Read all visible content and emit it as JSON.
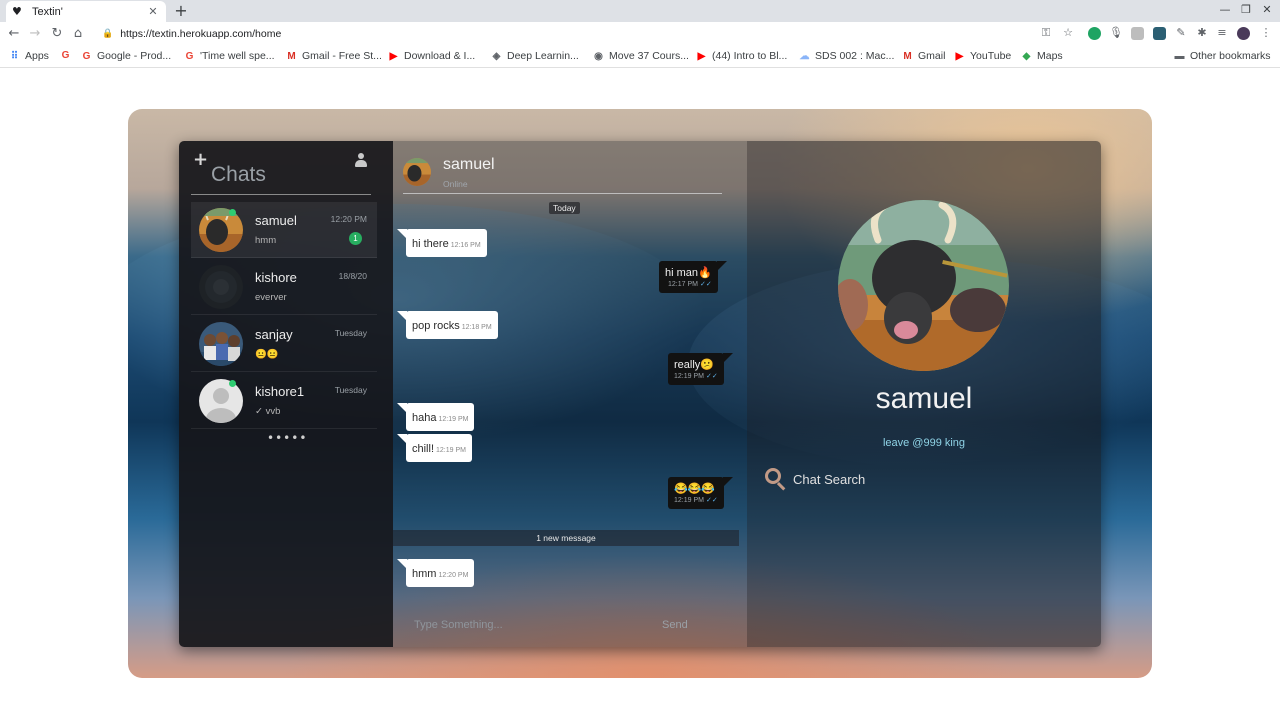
{
  "browser": {
    "tab_title": "Textin'",
    "url": "https://textin.herokuapp.com/home",
    "bookmarks": [
      {
        "label": "Apps",
        "icon": "apps-grid-icon"
      },
      {
        "label": "G",
        "icon": "google-icon"
      },
      {
        "label": "Google - Prod...",
        "icon": "google-icon"
      },
      {
        "label": "'Time well spe...",
        "icon": "google-icon"
      },
      {
        "label": "Gmail - Free St...",
        "icon": "gmail-icon"
      },
      {
        "label": "Download & I...",
        "icon": "youtube-icon"
      },
      {
        "label": "Deep Learnin...",
        "icon": "bookmark-icon"
      },
      {
        "label": "Move 37 Cours...",
        "icon": "bookmark-icon"
      },
      {
        "label": "(44) Intro to Bl...",
        "icon": "youtube-icon"
      },
      {
        "label": "SDS 002 : Mac...",
        "icon": "bookmark-icon"
      },
      {
        "label": "Gmail",
        "icon": "gmail-icon"
      },
      {
        "label": "YouTube",
        "icon": "youtube-icon"
      },
      {
        "label": "Maps",
        "icon": "maps-icon"
      }
    ],
    "other_bookmarks": "Other bookmarks"
  },
  "sidebar": {
    "title": "Chats",
    "chats": [
      {
        "name": "samuel",
        "time": "12:20 PM",
        "preview": "hmm",
        "unread": "1",
        "online": true,
        "active": true
      },
      {
        "name": "kishore",
        "time": "18/8/20",
        "preview": "everver",
        "unread": "",
        "online": false,
        "active": false
      },
      {
        "name": "sanjay",
        "time": "Tuesday",
        "preview": "😐😐",
        "unread": "",
        "online": false,
        "active": false
      },
      {
        "name": "kishore1",
        "time": "Tuesday",
        "preview": "✓ vvb",
        "unread": "",
        "online": true,
        "active": false
      }
    ],
    "more": "•••••"
  },
  "conversation": {
    "contact_name": "samuel",
    "status": "Online",
    "day_label": "Today",
    "messages": [
      {
        "direction": "in",
        "text": "hi there",
        "time": "12:16 PM"
      },
      {
        "direction": "out",
        "text": "hi man🔥",
        "time": "12:17 PM"
      },
      {
        "direction": "in",
        "text": "pop rocks",
        "time": "12:18 PM"
      },
      {
        "direction": "out",
        "text": "really😕",
        "time": "12:19 PM"
      },
      {
        "direction": "in",
        "text": "haha",
        "time": "12:19 PM"
      },
      {
        "direction": "in",
        "text": "chill!",
        "time": "12:19 PM"
      },
      {
        "direction": "out",
        "text": "😂😂😂",
        "time": "12:19 PM"
      },
      {
        "direction": "in",
        "text": "hmm",
        "time": "12:20 PM"
      }
    ],
    "new_message_label": "1 new message",
    "composer_placeholder": "Type Something...",
    "send_label": "Send"
  },
  "details": {
    "name": "samuel",
    "status_message": "leave @999 king",
    "search_label": "Chat Search"
  },
  "colors": {
    "online": "#2ecc71",
    "unread_badge": "#27ae60",
    "status_text": "#8fd3e6",
    "search_icon": "#c29a86",
    "read_ticks": "#5dade2"
  }
}
